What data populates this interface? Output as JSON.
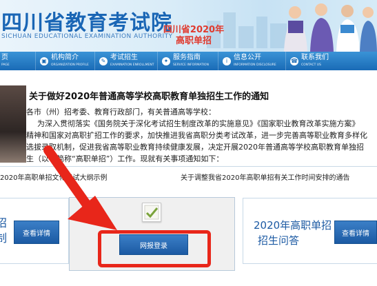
{
  "header": {
    "title": "四川省教育考试院",
    "subtitle": "SICHUAN EDUCATIONAL EXAMINATION AUTHORITY",
    "promo_line1": "四川省2020年",
    "promo_line2": "高职单招"
  },
  "nav": [
    {
      "zh": "页",
      "en": "PAGE",
      "icon": "home-icon"
    },
    {
      "zh": "机构简介",
      "en": "ORGANIZATION PROFILE",
      "icon": "profile-icon"
    },
    {
      "zh": "考试招生",
      "en": "EXAMINATION ENROLLMENT",
      "icon": "exam-icon"
    },
    {
      "zh": "服务指南",
      "en": "SERVICE INFORMATION",
      "icon": "service-icon"
    },
    {
      "zh": "信息公开",
      "en": "INFORMATION DISCLOSURE",
      "icon": "info-icon"
    },
    {
      "zh": "联系我们",
      "en": "CONTACT US",
      "icon": "contact-icon"
    }
  ],
  "article": {
    "title": "关于做好2020年普通高等学校高职教育单独招生工作的通知",
    "lines": [
      "各市（州）招考委、教育行政部门，有关普通高等学校：",
      "为深入贯彻落实《国务院关于深化考试招生制度改革的实施意见》《国家职业教育改革实施方案》",
      "精神和国家对高职扩招工作的要求，加快推进我省高职分类考试改革，进一步完善高等职业教育多样化",
      "选拔录取机制，促进我省高等职业教育持续健康发展，决定开展2020年普通高等学校高职教育单独招",
      "生（以下简称“高职单招”）工作。现就有关事项通知如下："
    ]
  },
  "links": {
    "left": "2020年高职单招文化考试大纲示例",
    "right": "关于调整我省2020年高职单招有关工作时间安排的通告"
  },
  "cards": {
    "left_text_1": "招",
    "left_text_2": "制",
    "left_button": "查看详情",
    "center_button": "网报登录",
    "right_text_1": "2020年高职单招",
    "right_text_2": "招生问答",
    "right_button": "查看详情"
  },
  "colors": {
    "accent": "#1c5aa3",
    "highlight": "#e8261a"
  }
}
